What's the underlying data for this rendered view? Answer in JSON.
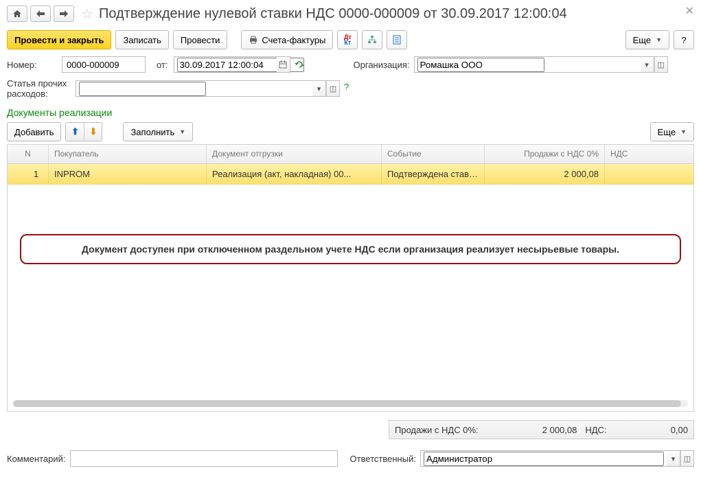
{
  "header": {
    "title": "Подтверждение нулевой ставки НДС 0000-000009 от 30.09.2017 12:00:04"
  },
  "toolbar": {
    "post_close": "Провести и закрыть",
    "save": "Записать",
    "post": "Провести",
    "invoices": "Счета-фактуры",
    "more": "Еще",
    "help": "?"
  },
  "form": {
    "number_label": "Номер:",
    "number_value": "0000-000009",
    "from_label": "от:",
    "date_value": "30.09.2017 12:00:04",
    "org_label": "Организация:",
    "org_value": "Ромашка ООО",
    "expense_label_1": "Статья прочих",
    "expense_label_2": "расходов:",
    "expense_value": "",
    "question": "?"
  },
  "section": {
    "title": "Документы реализации"
  },
  "table_toolbar": {
    "add": "Добавить",
    "fill": "Заполнить",
    "more": "Еще"
  },
  "table": {
    "headers": {
      "n": "N",
      "buyer": "Покупатель",
      "doc": "Документ отгрузки",
      "event": "Событие",
      "sales": "Продажи с НДС 0%",
      "vat": "НДС"
    },
    "rows": [
      {
        "n": "1",
        "buyer": "INPROM",
        "doc": "Реализация (акт, накладная) 00...",
        "event": "Подтверждена ставк...",
        "sales": "2 000,08",
        "vat": ""
      }
    ],
    "banner": "Документ доступен при отключенном раздельном учете НДС если организация реализует несырьевые товары."
  },
  "summary": {
    "sales_label": "Продажи с НДС 0%:",
    "sales_value": "2 000,08",
    "vat_label": "НДС:",
    "vat_value": "0,00"
  },
  "footer": {
    "comment_label": "Комментарий:",
    "comment_value": "",
    "resp_label": "Ответственный:",
    "resp_value": "Администратор"
  }
}
